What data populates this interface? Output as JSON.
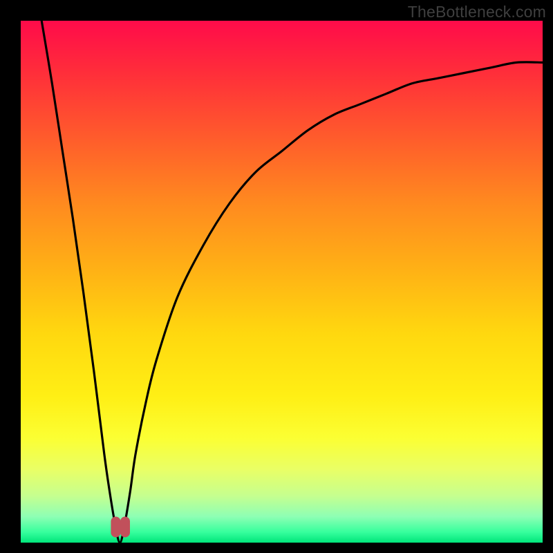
{
  "watermark": "TheBottleneck.com",
  "colors": {
    "frame": "#000000",
    "curve_stroke": "#000000",
    "marker_fill": "#c1505b",
    "marker_stroke": "#c1505b"
  },
  "chart_data": {
    "type": "line",
    "title": "",
    "xlabel": "",
    "ylabel": "",
    "xlim": [
      0,
      100
    ],
    "ylim": [
      0,
      100
    ],
    "grid": false,
    "legend": false,
    "note": "Bottleneck-style curve. y≈0 at x≈19 (optimal point); curve rises steeply toward 100 on both sides, faster on the left. Values estimated from pixels.",
    "series": [
      {
        "name": "bottleneck-curve",
        "x": [
          4,
          6,
          8,
          10,
          12,
          14,
          16,
          17,
          18,
          19,
          20,
          21,
          22,
          24,
          26,
          30,
          35,
          40,
          45,
          50,
          55,
          60,
          65,
          70,
          75,
          80,
          85,
          90,
          95,
          100
        ],
        "values": [
          100,
          88,
          75,
          62,
          48,
          33,
          17,
          10,
          4,
          0,
          4,
          10,
          17,
          27,
          35,
          47,
          57,
          65,
          71,
          75,
          79,
          82,
          84,
          86,
          88,
          89,
          90,
          91,
          92,
          92
        ]
      }
    ],
    "markers": [
      {
        "x": 18.2,
        "y": 3.0
      },
      {
        "x": 20.0,
        "y": 3.0
      }
    ]
  }
}
